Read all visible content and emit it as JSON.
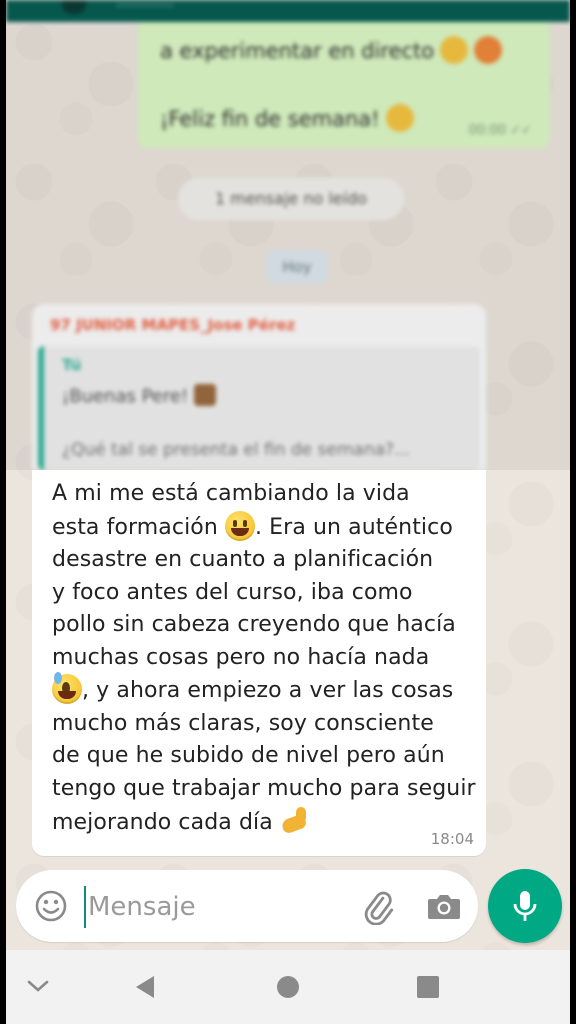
{
  "header": {
    "title": "··············"
  },
  "previous_sent_message": {
    "line1": "a experimentar en directo",
    "line2": "¡Feliz fin de semana!",
    "time": "00:00 ✓✓"
  },
  "unread_pill": {
    "text": "1 mensaje no leído"
  },
  "day_pill": {
    "text": "Hoy"
  },
  "received_message": {
    "sender": "97 JUNIOR MAPES_Jose Pérez",
    "quote": {
      "author": "Tú",
      "line1": "¡Buenas Pere!",
      "line2": "¿Qué tal se presenta el fin de semana?..."
    },
    "text_lines": [
      [
        "A mi me está cambiando la vida"
      ],
      [
        "esta formación ",
        {
          "emoji": "grinning-face-icon"
        },
        ". Era un auténtico"
      ],
      [
        "desastre en cuanto a planificación"
      ],
      [
        "y foco antes del curso, iba como"
      ],
      [
        "pollo sin cabeza creyendo que hacía"
      ],
      [
        "muchas cosas pero no hacía nada"
      ],
      [
        {
          "emoji": "sweat-smile-icon"
        },
        ", y ahora empiezo a ver las cosas"
      ],
      [
        "mucho más claras, soy consciente"
      ],
      [
        "de que he subido de nivel pero aún"
      ],
      [
        "tengo que trabajar mucho para seguir"
      ],
      [
        "mejorando cada día ",
        {
          "emoji": "flexed-biceps-icon"
        }
      ]
    ],
    "time": "18:04"
  },
  "composer": {
    "placeholder": "Mensaje",
    "value": ""
  },
  "icons": {
    "emoji": "smiley-icon",
    "attach": "paperclip-icon",
    "camera": "camera-icon",
    "mic": "microphone-icon",
    "nav_down": "chevron-down-icon",
    "nav_back": "back-triangle-icon",
    "nav_home": "home-circle-icon",
    "nav_recents": "recents-square-icon"
  },
  "colors": {
    "app_bar": "#075e54",
    "sent_bubble": "#dcf8c6",
    "received_bubble": "#ffffff",
    "sender_name": "#f0674a",
    "accent": "#00a884",
    "chat_background": "#ece5dd"
  }
}
